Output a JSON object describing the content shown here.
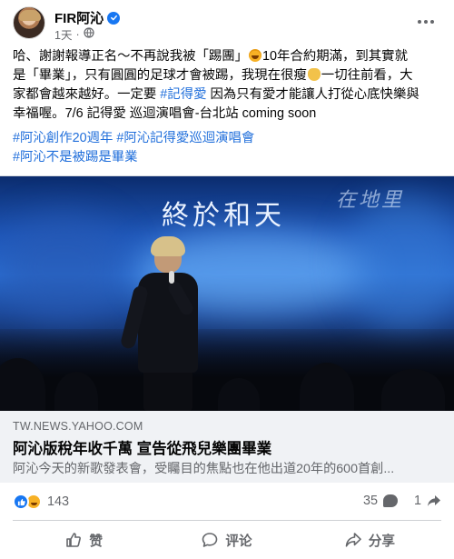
{
  "post": {
    "page_name": "FIR阿沁",
    "timestamp": "1天",
    "privacy_icon": "globe-icon",
    "message_lines": [
      {
        "before": "哈、謝謝報導正名～不再說我被「踢團」",
        "emoji": "laugh",
        "after": "10年合約期滿，到其實就"
      },
      {
        "text": "是「畢業」，只有圓圓的足球才會被踢，我現在很瘦",
        "emoji": "hands",
        "after": "一切往前看，大"
      },
      {
        "text": "家都會越來越好。一定要 ",
        "hashtag": "#記得愛",
        "after": " 因為只有愛才能讓人打從心底快樂與"
      },
      {
        "text": "幸福喔。7/6 記得愛 巡迴演唱會-台北站 coming soon"
      }
    ],
    "hashtags_line1": [
      "#阿沁創作20週年",
      "#阿沁記得愛巡迴演唱會"
    ],
    "hashtags_line2": [
      "#阿沁不是被踢是畢業"
    ]
  },
  "link_preview": {
    "image_text_main": "終於和天",
    "image_text_faint": "在地里",
    "source": "TW.NEWS.YAHOO.COM",
    "headline": "阿沁版稅年收千萬 宣告從飛兒樂團畢業",
    "excerpt": "阿沁今天的新歌發表會，受矚目的焦點也在他出道20年的600首創..."
  },
  "engagement": {
    "reaction_icons": [
      "like-icon",
      "haha-icon"
    ],
    "reaction_count": "143",
    "comment_count": "35",
    "share_count": "1"
  },
  "actions": {
    "like_label": "赞",
    "comment_label": "评论",
    "share_label": "分享"
  },
  "colors": {
    "link_blue": "#216fdb",
    "verified_blue": "#1877f2",
    "secondary_text": "#65676b",
    "preview_bg": "#f0f2f5"
  }
}
